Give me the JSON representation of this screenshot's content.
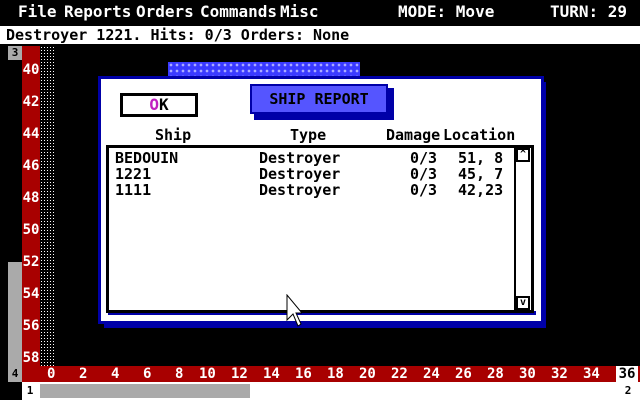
{
  "menu": {
    "items": [
      "File",
      "Reports",
      "Orders",
      "Commands",
      "Misc"
    ],
    "mode_label": "MODE: Move",
    "turn_label": "TURN: 29"
  },
  "status": {
    "text": "Destroyer 1221. Hits: 0/3 Orders: None"
  },
  "ruler": {
    "corner_top_left": "3",
    "corner_bottom_left": "4",
    "y_labels": [
      "40",
      "42",
      "44",
      "46",
      "48",
      "50",
      "52",
      "54",
      "56",
      "58"
    ],
    "x_labels": [
      "0",
      "2",
      "4",
      "6",
      "8",
      "10",
      "12",
      "14",
      "16",
      "18",
      "20",
      "22",
      "24",
      "26",
      "28",
      "30",
      "32",
      "34",
      "36"
    ],
    "scroll_left": "1",
    "scroll_right": "2"
  },
  "dialog": {
    "ok_hotkey": "O",
    "ok_rest": "K",
    "title": "SHIP REPORT",
    "columns": [
      "Ship",
      "Type",
      "Damage",
      "Location"
    ],
    "rows": [
      {
        "ship": "BEDOUIN",
        "type": "Destroyer",
        "damage": "0/3",
        "location": "51, 8"
      },
      {
        "ship": "1221",
        "type": "Destroyer",
        "damage": "0/3",
        "location": "45, 7"
      },
      {
        "ship": "1111",
        "type": "Destroyer",
        "damage": "0/3",
        "location": "42,23"
      }
    ],
    "scroll_up": "^",
    "scroll_down": "v"
  },
  "colors": {
    "ruler_red": "#a80000",
    "dialog_blue": "#0000a8",
    "title_blue": "#5555ff",
    "hotkey_magenta": "#c020c0"
  }
}
